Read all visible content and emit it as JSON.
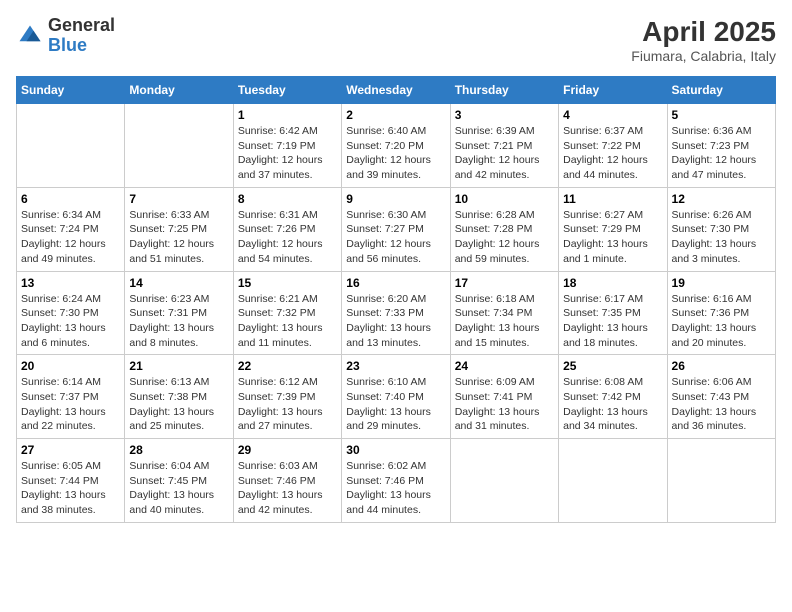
{
  "header": {
    "logo_general": "General",
    "logo_blue": "Blue",
    "title": "April 2025",
    "subtitle": "Fiumara, Calabria, Italy"
  },
  "weekdays": [
    "Sunday",
    "Monday",
    "Tuesday",
    "Wednesday",
    "Thursday",
    "Friday",
    "Saturday"
  ],
  "weeks": [
    [
      null,
      null,
      {
        "day": "1",
        "sunrise": "6:42 AM",
        "sunset": "7:19 PM",
        "daylight": "12 hours and 37 minutes."
      },
      {
        "day": "2",
        "sunrise": "6:40 AM",
        "sunset": "7:20 PM",
        "daylight": "12 hours and 39 minutes."
      },
      {
        "day": "3",
        "sunrise": "6:39 AM",
        "sunset": "7:21 PM",
        "daylight": "12 hours and 42 minutes."
      },
      {
        "day": "4",
        "sunrise": "6:37 AM",
        "sunset": "7:22 PM",
        "daylight": "12 hours and 44 minutes."
      },
      {
        "day": "5",
        "sunrise": "6:36 AM",
        "sunset": "7:23 PM",
        "daylight": "12 hours and 47 minutes."
      }
    ],
    [
      {
        "day": "6",
        "sunrise": "6:34 AM",
        "sunset": "7:24 PM",
        "daylight": "12 hours and 49 minutes."
      },
      {
        "day": "7",
        "sunrise": "6:33 AM",
        "sunset": "7:25 PM",
        "daylight": "12 hours and 51 minutes."
      },
      {
        "day": "8",
        "sunrise": "6:31 AM",
        "sunset": "7:26 PM",
        "daylight": "12 hours and 54 minutes."
      },
      {
        "day": "9",
        "sunrise": "6:30 AM",
        "sunset": "7:27 PM",
        "daylight": "12 hours and 56 minutes."
      },
      {
        "day": "10",
        "sunrise": "6:28 AM",
        "sunset": "7:28 PM",
        "daylight": "12 hours and 59 minutes."
      },
      {
        "day": "11",
        "sunrise": "6:27 AM",
        "sunset": "7:29 PM",
        "daylight": "13 hours and 1 minute."
      },
      {
        "day": "12",
        "sunrise": "6:26 AM",
        "sunset": "7:30 PM",
        "daylight": "13 hours and 3 minutes."
      }
    ],
    [
      {
        "day": "13",
        "sunrise": "6:24 AM",
        "sunset": "7:30 PM",
        "daylight": "13 hours and 6 minutes."
      },
      {
        "day": "14",
        "sunrise": "6:23 AM",
        "sunset": "7:31 PM",
        "daylight": "13 hours and 8 minutes."
      },
      {
        "day": "15",
        "sunrise": "6:21 AM",
        "sunset": "7:32 PM",
        "daylight": "13 hours and 11 minutes."
      },
      {
        "day": "16",
        "sunrise": "6:20 AM",
        "sunset": "7:33 PM",
        "daylight": "13 hours and 13 minutes."
      },
      {
        "day": "17",
        "sunrise": "6:18 AM",
        "sunset": "7:34 PM",
        "daylight": "13 hours and 15 minutes."
      },
      {
        "day": "18",
        "sunrise": "6:17 AM",
        "sunset": "7:35 PM",
        "daylight": "13 hours and 18 minutes."
      },
      {
        "day": "19",
        "sunrise": "6:16 AM",
        "sunset": "7:36 PM",
        "daylight": "13 hours and 20 minutes."
      }
    ],
    [
      {
        "day": "20",
        "sunrise": "6:14 AM",
        "sunset": "7:37 PM",
        "daylight": "13 hours and 22 minutes."
      },
      {
        "day": "21",
        "sunrise": "6:13 AM",
        "sunset": "7:38 PM",
        "daylight": "13 hours and 25 minutes."
      },
      {
        "day": "22",
        "sunrise": "6:12 AM",
        "sunset": "7:39 PM",
        "daylight": "13 hours and 27 minutes."
      },
      {
        "day": "23",
        "sunrise": "6:10 AM",
        "sunset": "7:40 PM",
        "daylight": "13 hours and 29 minutes."
      },
      {
        "day": "24",
        "sunrise": "6:09 AM",
        "sunset": "7:41 PM",
        "daylight": "13 hours and 31 minutes."
      },
      {
        "day": "25",
        "sunrise": "6:08 AM",
        "sunset": "7:42 PM",
        "daylight": "13 hours and 34 minutes."
      },
      {
        "day": "26",
        "sunrise": "6:06 AM",
        "sunset": "7:43 PM",
        "daylight": "13 hours and 36 minutes."
      }
    ],
    [
      {
        "day": "27",
        "sunrise": "6:05 AM",
        "sunset": "7:44 PM",
        "daylight": "13 hours and 38 minutes."
      },
      {
        "day": "28",
        "sunrise": "6:04 AM",
        "sunset": "7:45 PM",
        "daylight": "13 hours and 40 minutes."
      },
      {
        "day": "29",
        "sunrise": "6:03 AM",
        "sunset": "7:46 PM",
        "daylight": "13 hours and 42 minutes."
      },
      {
        "day": "30",
        "sunrise": "6:02 AM",
        "sunset": "7:46 PM",
        "daylight": "13 hours and 44 minutes."
      },
      null,
      null,
      null
    ]
  ],
  "labels": {
    "sunrise": "Sunrise:",
    "sunset": "Sunset:",
    "daylight": "Daylight:"
  }
}
